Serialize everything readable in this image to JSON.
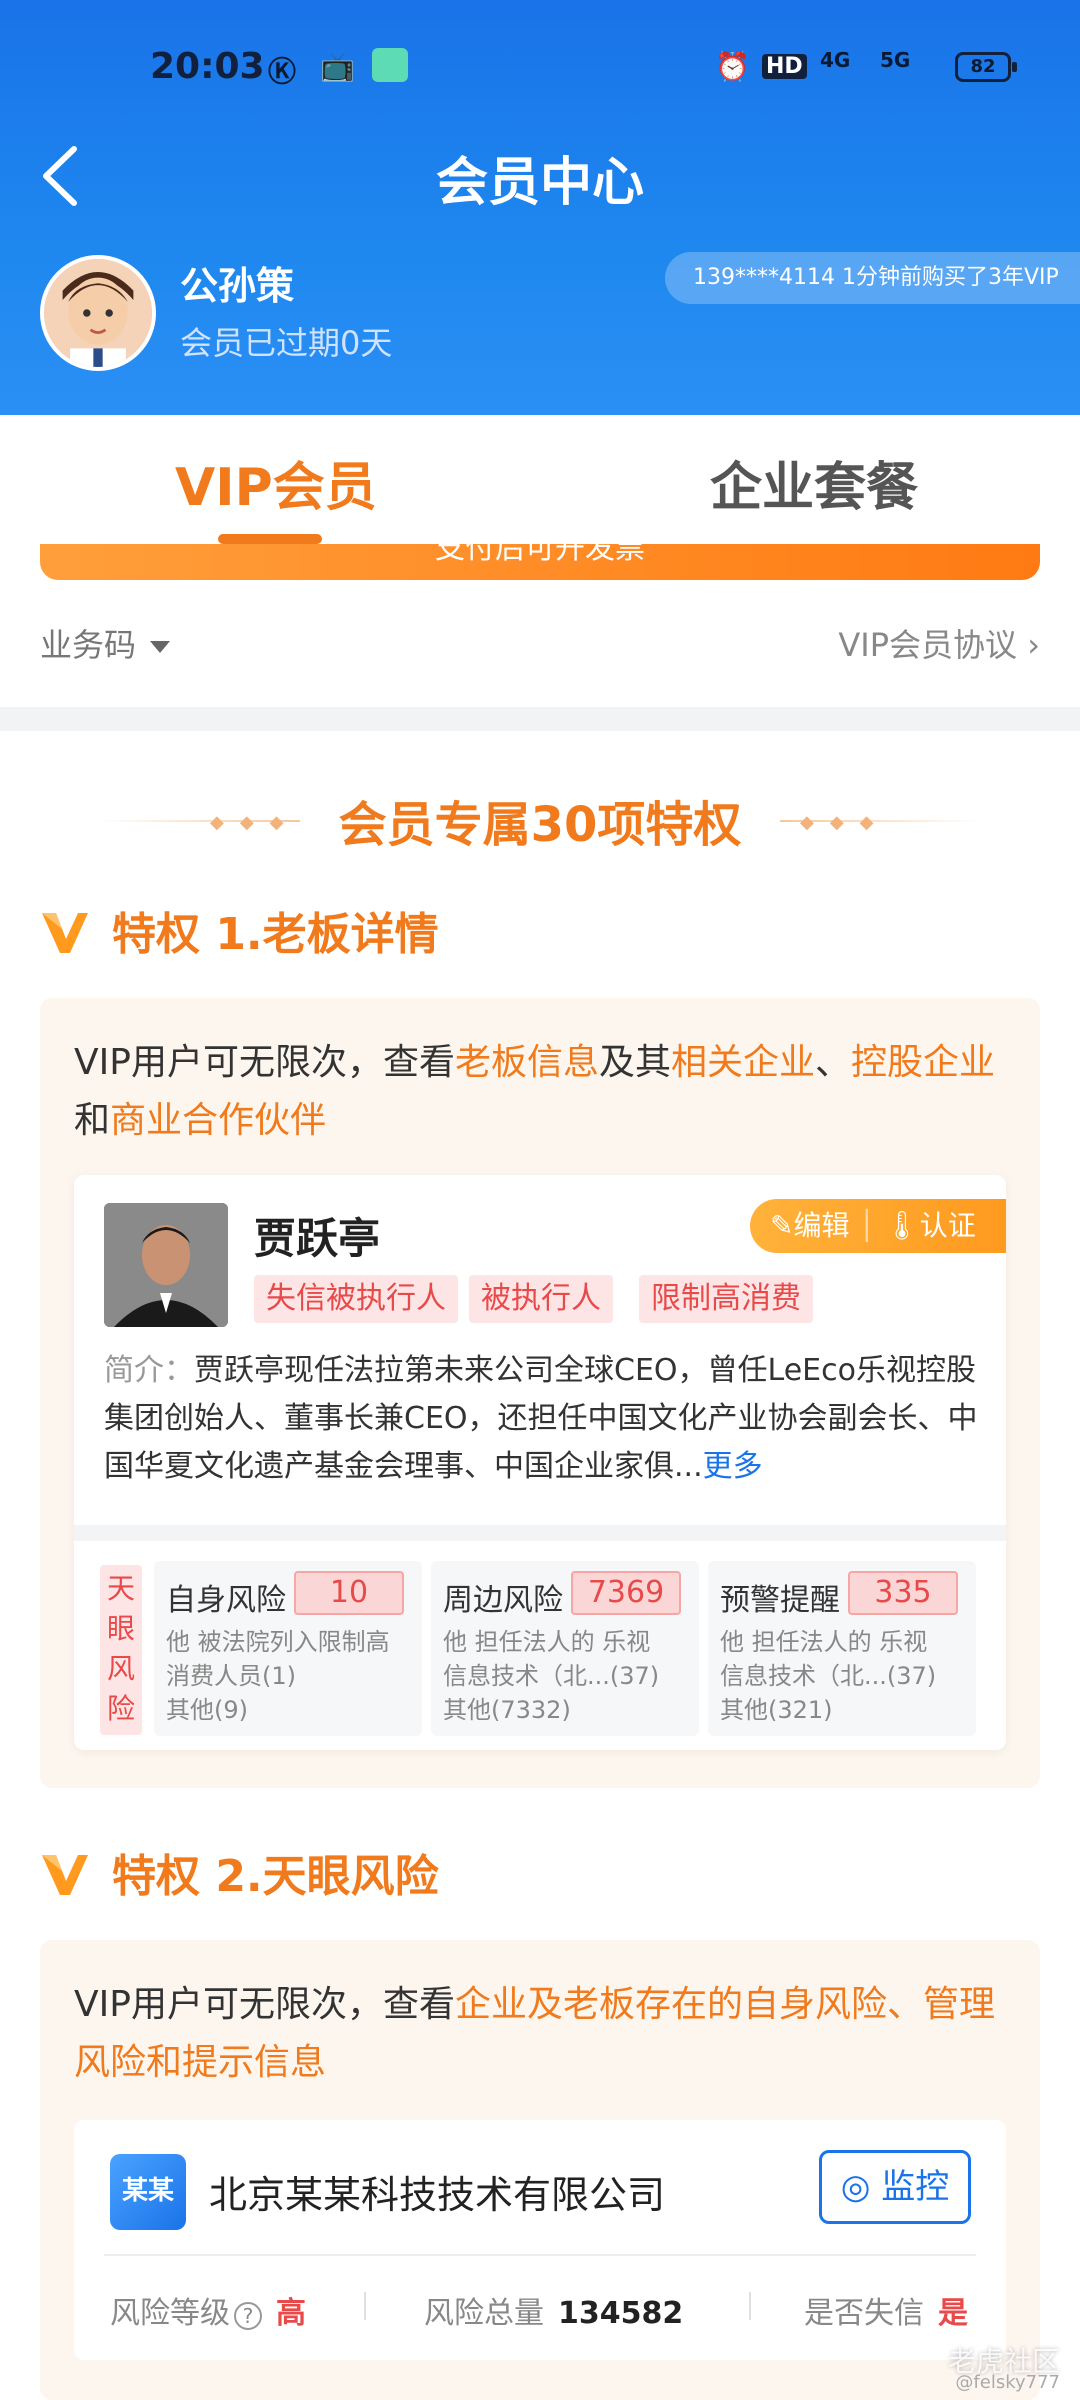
{
  "status_bar": {
    "time": "20:03",
    "battery": "82",
    "network": "4G",
    "network2": "5G",
    "hd": "HD"
  },
  "header": {
    "title": "会员中心"
  },
  "user": {
    "name": "公孙策",
    "status": "会员已过期0天"
  },
  "ticker": "139****4114 1分钟前购买了3年VIP",
  "tabs": [
    {
      "label": "VIP会员"
    },
    {
      "label": "企业套餐"
    }
  ],
  "orange_bar_text": "支付后可开发票",
  "bizcode": "业务码",
  "agreement": "VIP会员协议",
  "section_title": "会员专属30项特权",
  "privilege1": {
    "title": "特权 1.老板详情",
    "desc_parts": [
      "VIP用户可无限次，查看",
      "老板信息",
      "及其",
      "相关企业",
      "、",
      "控股企业",
      "和",
      "商业合作伙伴"
    ]
  },
  "boss": {
    "name": "贾跃亭",
    "edit": "编辑",
    "verify": "认证",
    "tags": [
      "失信被执行人",
      "被执行人",
      "限制高消费"
    ],
    "intro_label": "简介：",
    "intro": "贾跃亭现任法拉第未来公司全球CEO，曾任LeEco乐视控股集团创始人、董事长兼CEO，还担任中国文化产业协会副会长、中国华夏文化遗产基金会理事、中国企业家俱...",
    "more": "更多",
    "risk_side": "天眼风险",
    "risks": [
      {
        "title": "自身风险",
        "count": "10",
        "desc1": "他 被法院列入限制高",
        "desc2": "消费人员(1)",
        "desc3": "其他(9)"
      },
      {
        "title": "周边风险",
        "count": "7369",
        "desc1": "他 担任法人的 乐视",
        "desc2": "信息技术（北...(37)",
        "desc3": "其他(7332)"
      },
      {
        "title": "预警提醒",
        "count": "335",
        "desc1": "他 担任法人的 乐视",
        "desc2": "信息技术（北...(37)",
        "desc3": "其他(321)"
      }
    ]
  },
  "privilege2": {
    "title": "特权 2.天眼风险",
    "desc_prefix": "VIP用户可无限次，查看",
    "desc_hl": "企业及老板存在的自身风险、管理风险和提示信息"
  },
  "company": {
    "logo": "某某",
    "name": "北京某某科技技术有限公司",
    "monitor": "监控",
    "risk_level_label": "风险等级",
    "risk_level": "高",
    "risk_total_label": "风险总量",
    "risk_total": "134582",
    "dishonest_label": "是否失信",
    "dishonest": "是"
  },
  "watermark": "老虎社区",
  "watermark_user": "@felsky777",
  "colors": {
    "brand_blue": "#1a73e8",
    "accent_orange": "#f07a1c",
    "risk_red": "#e84a4a"
  }
}
